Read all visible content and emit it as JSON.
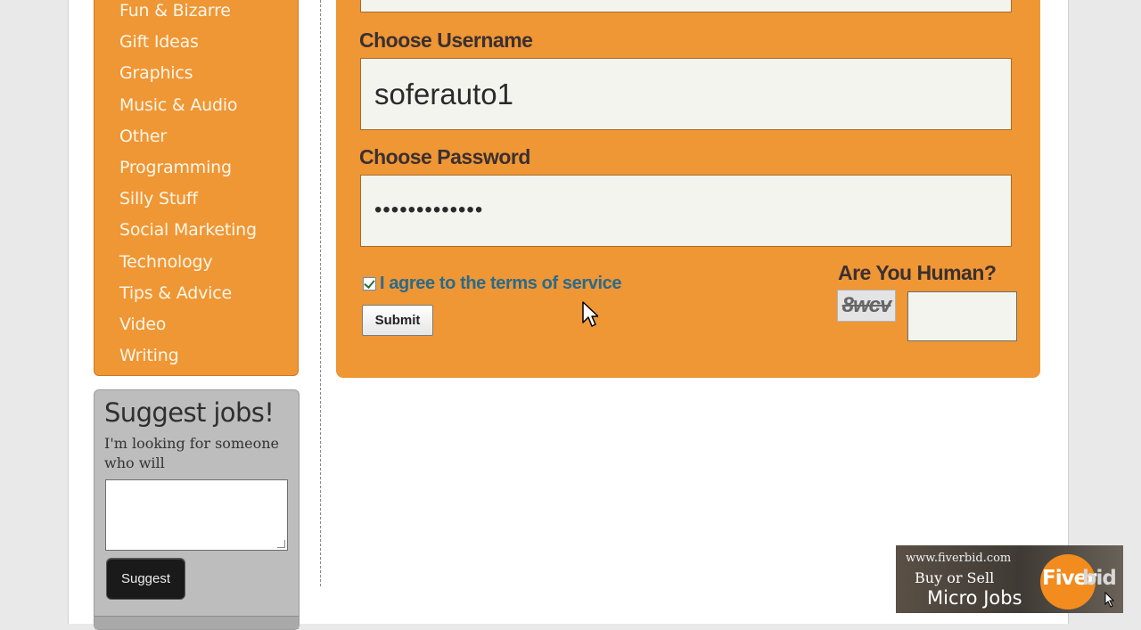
{
  "sidebar": {
    "categories": [
      "Fun & Bizarre",
      "Gift Ideas",
      "Graphics",
      "Music & Audio",
      "Other",
      "Programming",
      "Silly Stuff",
      "Social Marketing",
      "Technology",
      "Tips & Advice",
      "Video",
      "Writing"
    ]
  },
  "suggest": {
    "title": "Suggest jobs!",
    "subtitle": "I'm looking for someone who will",
    "button_label": "Suggest"
  },
  "form": {
    "username_label": "Choose Username",
    "username_value": "soferauto1",
    "password_label": "Choose Password",
    "password_value": "•••••••••••••",
    "agree_label": "I agree to the terms of service",
    "agree_checked": true,
    "submit_label": "Submit",
    "human_label": "Are You Human?",
    "captcha_text": "8wcv"
  },
  "ad": {
    "url": "www.fiverbid.com",
    "line1": "Buy or Sell",
    "line2": "Micro Jobs",
    "logo_part1": "Fiver",
    "logo_part2": "bid"
  },
  "colors": {
    "accent_orange": "#ef9635",
    "link_blue": "#2b6a8a"
  }
}
